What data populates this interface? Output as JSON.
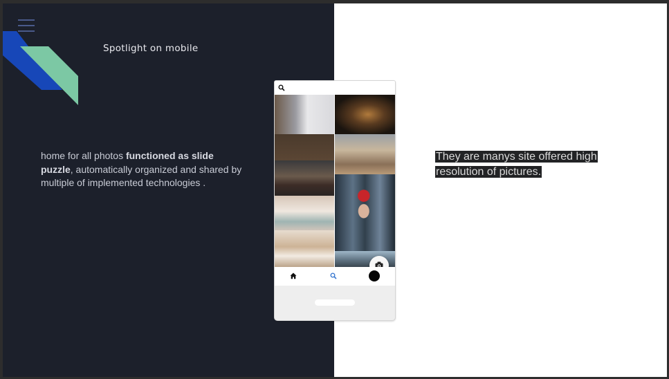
{
  "slide": {
    "title": "Spotlight on mobile",
    "body_prefix": "home for all photos ",
    "body_bold": "functioned as slide puzzle",
    "body_suffix": ", automatically organized and  shared by multiple of implemented technologies .",
    "right_line1": "They are manys site offered high",
    "right_line2": "resolution of pictures."
  },
  "icons": {
    "menu": "hamburger-menu-icon",
    "search": "search-icon",
    "camera": "camera-icon",
    "home": "home-icon",
    "avatar": "profile-avatar"
  },
  "colors": {
    "left_background": "#1c202b",
    "accent_blue": "#1747b8",
    "accent_green": "#7cc8a4",
    "right_background": "#ffffff"
  }
}
